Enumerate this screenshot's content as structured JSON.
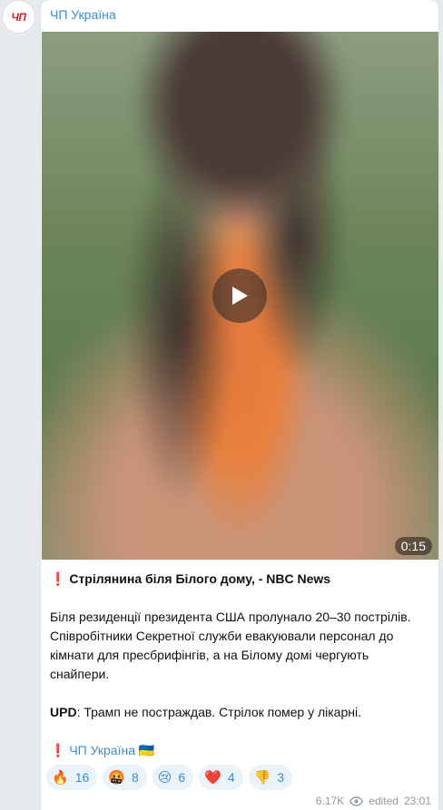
{
  "channel": {
    "avatar_text": "ЧП",
    "name": "ЧП Україна"
  },
  "video": {
    "duration": "0:15"
  },
  "post": {
    "headline_mark": "❗",
    "headline": "Стрілянина біля Білого дому, - NBC News",
    "paragraph": "Біля резиденції президента США пролунало 20–30 пострілів. Співробітники Секретної служби евакуювали персонал до кімнати для пресбрифінгів, а на Білому домі чергують снайпери.",
    "upd_label": "UPD",
    "upd_text": ": Трамп не постраждав. Стрілок помер у лікарні.",
    "signature_mark": "❗",
    "signature_link": "ЧП Україна",
    "signature_flag": "🇺🇦"
  },
  "reactions": [
    {
      "emoji": "🔥",
      "icon": "fire-icon",
      "count": "16"
    },
    {
      "emoji": "🤬",
      "icon": "angry-face-icon",
      "count": "8"
    },
    {
      "emoji": "😢",
      "icon": "crying-face-icon",
      "count": "6"
    },
    {
      "emoji": "❤️",
      "icon": "heart-icon",
      "count": "4"
    },
    {
      "emoji": "👎",
      "icon": "thumbs-down-icon",
      "count": "3"
    }
  ],
  "meta": {
    "views": "6.17K",
    "edited": "edited",
    "time": "23:01"
  },
  "colors": {
    "link": "#3a8fd0",
    "background": "#e7ebf0",
    "bubble": "#ffffff",
    "alert": "#d4171c"
  }
}
